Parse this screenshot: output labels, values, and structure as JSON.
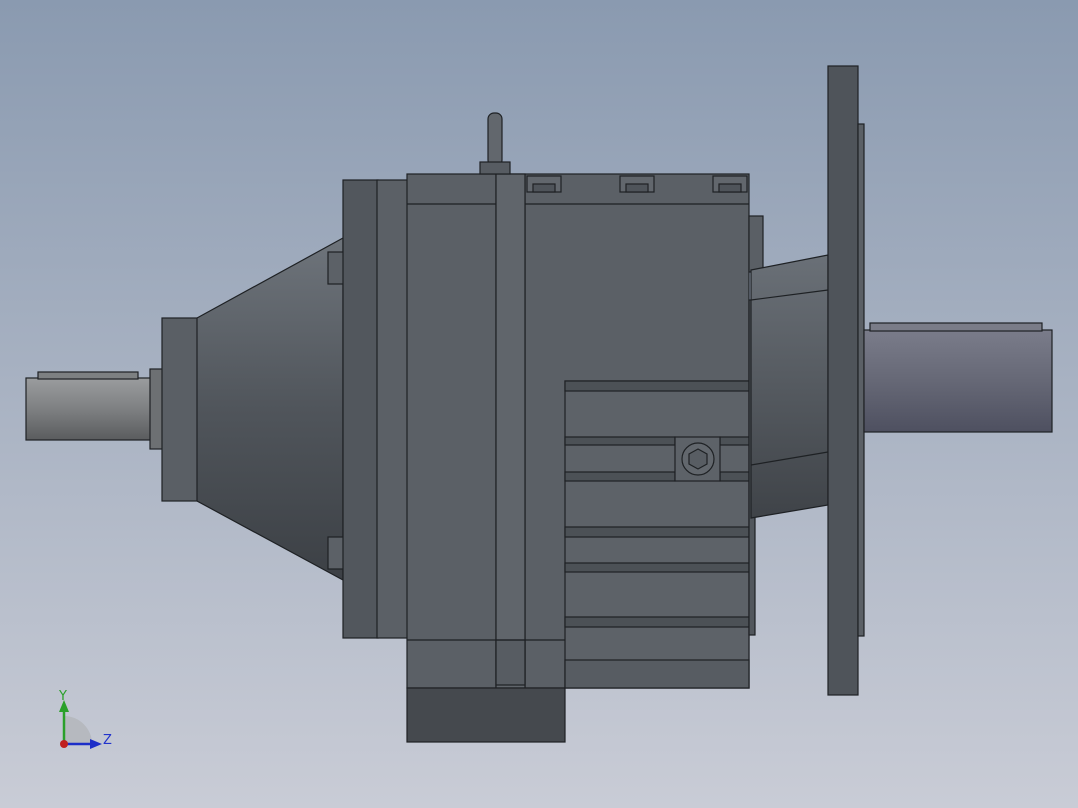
{
  "viewport": {
    "background_top": "#8a9ab0",
    "background_bottom": "#c9ccd6"
  },
  "model": {
    "body_color": "#5b6066",
    "body_dark": "#474c52",
    "body_light": "#6a7077",
    "edge_color": "#1e2124",
    "input_shaft_color": "#8a8c8e",
    "output_shaft_color": "#6b6d7a"
  },
  "triad": {
    "y_label": "Y",
    "z_label": "Z",
    "y_color": "#2aa02a",
    "z_color": "#1c2ec8",
    "x_color": "#c02020"
  }
}
